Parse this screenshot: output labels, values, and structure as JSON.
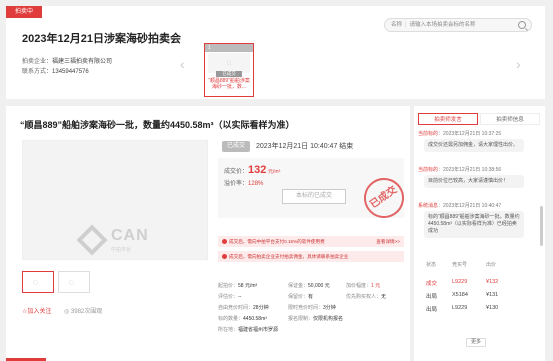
{
  "top": {
    "badge": "拍卖中",
    "title": "2023年12月21日涉案海砂拍卖会",
    "org_label": "拍卖企业：",
    "org_value": "福建三福拍卖有限公司",
    "phone_label": "联系方式：",
    "phone_value": "13459447576",
    "search_prefix": "名称",
    "search_placeholder": "请输入本场拍卖会标的名称",
    "thumb_num": "1",
    "thumb_status": "已成交",
    "thumb_caption": "“顺昌889”船舶涉案海砂一批，数..."
  },
  "main": {
    "title": "“顺昌889”船舶涉案海砂一批，数量约4450.58m³（以实际看样为准）",
    "status": "已成交",
    "end_time": "2023年12月21日  10:40:47 结束",
    "deal_label": "成交价：",
    "deal_price": "132",
    "deal_unit": "元/m³",
    "premium_label": "溢价率：",
    "premium_value": "128%",
    "ended_button": "本标的已成交",
    "seal_text": "已成交",
    "notice1": "成交后，需向中拍平台支付0.15%的软件使用费",
    "notice1_link": "查看详情>>",
    "notice2": "成交后，需向拍卖企业支付拍卖佣金，具体请联系拍卖企业",
    "logo_text": "CAN",
    "logo_sub": "中拍平台",
    "fav": "☆加入关注",
    "views": "3982次围观",
    "fields": [
      {
        "label": "起拍价：",
        "value": "58 元/m³"
      },
      {
        "label": "保证金：",
        "value": "50,000 元"
      },
      {
        "label": "加价幅度：",
        "value": "1 元"
      },
      {
        "label": "评估价：",
        "value": "--"
      },
      {
        "label": "保留价：",
        "value": "有"
      },
      {
        "label": "优先购买权人：",
        "value": "无"
      },
      {
        "label": "自由竞价时间：",
        "value": "28分钟"
      },
      {
        "label": "限时竞价时间：",
        "value": "3分钟"
      },
      {
        "label": "标的数量：",
        "value": "4450.58m³"
      },
      {
        "label": "报名限制：",
        "value": "仅限机构报名"
      },
      {
        "label": "所在地：",
        "value": "福建省福州市罗源"
      }
    ]
  },
  "side": {
    "tab_active": "拍卖师发言",
    "tab_inactive": "拍卖师信息",
    "messages": [
      {
        "who": "当前标的",
        "time": "2023年12月21日  10:37:25",
        "text": "成交价还需另加佣金，请大家理性出价。"
      },
      {
        "who": "当前标的",
        "time": "2023年12月21日  10:38:56",
        "text": "目前价位已较高，大家请谨慎出价！"
      },
      {
        "who": "系统消息",
        "time": "2023年12月21日  10:40:47",
        "text": "标的“顺昌889”船舶涉案海砂一批，数量约4450.58m³（以实际看样为准）已经拍卖成功"
      }
    ],
    "bid_headers": [
      "状态",
      "竞买号",
      "出价"
    ],
    "bids": [
      {
        "state": "成交",
        "num": "L9229",
        "price": "¥132"
      },
      {
        "state": "出局",
        "num": "X5184",
        "price": "¥131"
      },
      {
        "state": "出局",
        "num": "L9229",
        "price": "¥130"
      }
    ],
    "more": "更多"
  }
}
